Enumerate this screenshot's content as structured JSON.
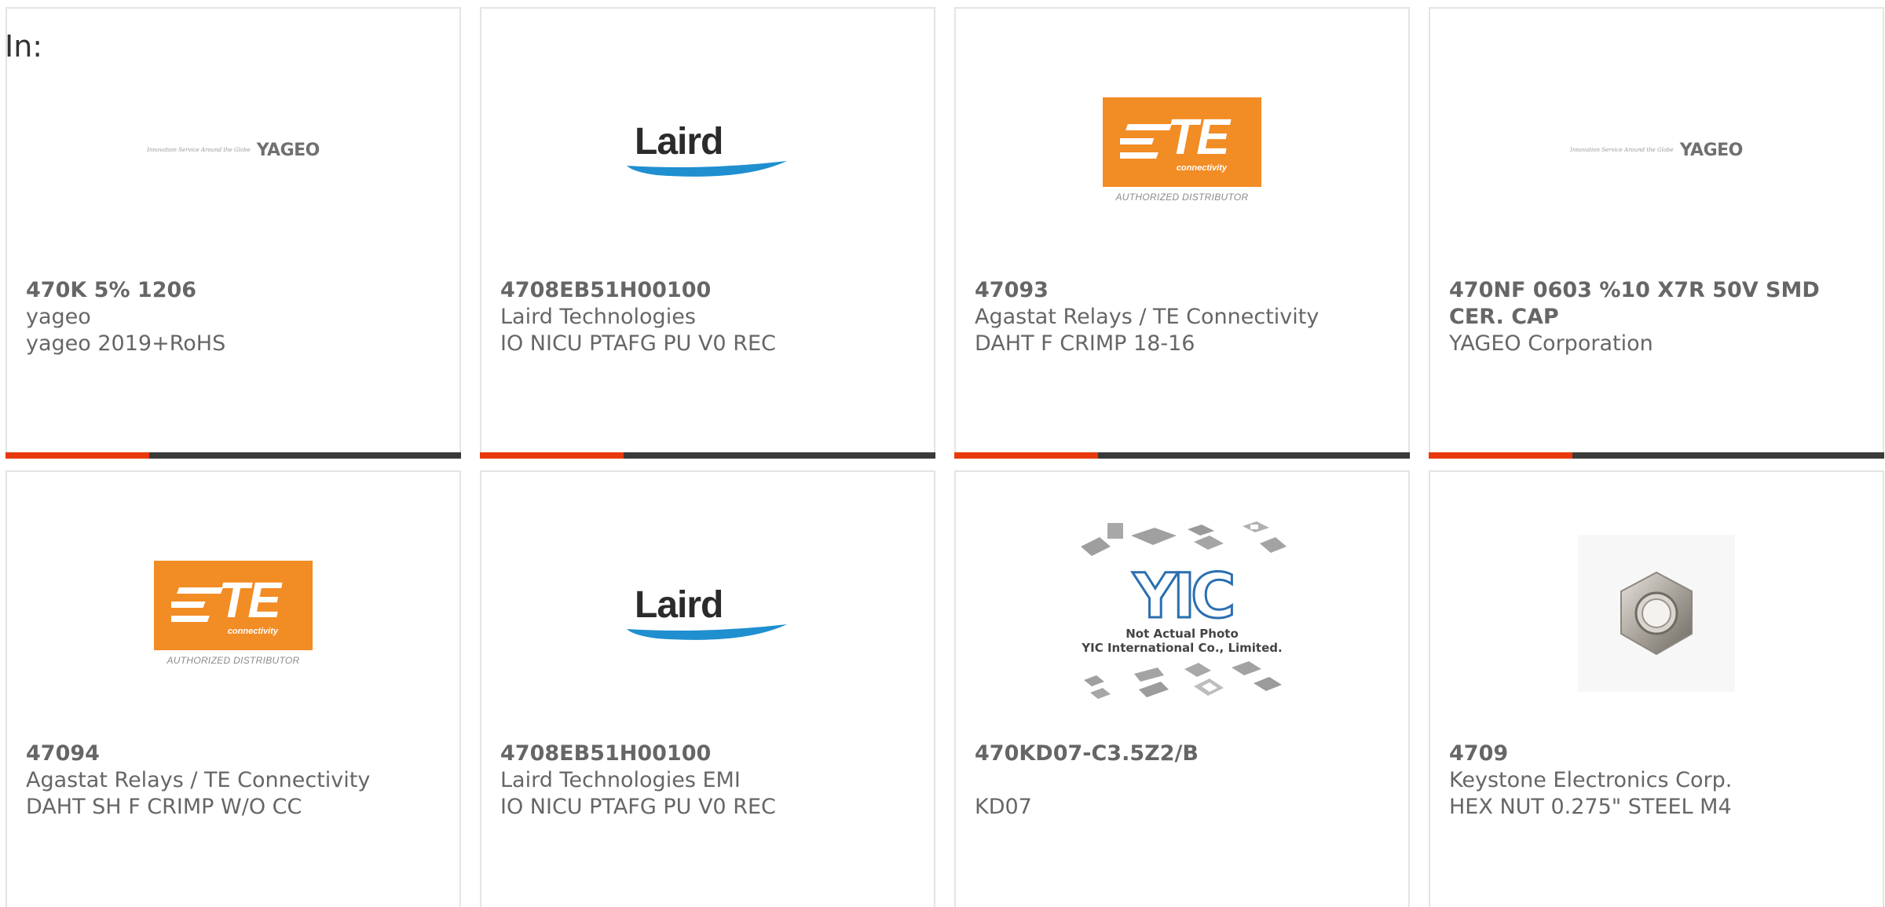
{
  "filter": {
    "label": "In:"
  },
  "products": [
    {
      "part_number": "470K 5% 1206",
      "manufacturer": "yageo",
      "description": "yageo 2019+RoHS",
      "logo": "yageo"
    },
    {
      "part_number": "4708EB51H00100",
      "manufacturer": "Laird Technologies",
      "description": "IO NICU PTAFG PU V0 REC",
      "logo": "laird"
    },
    {
      "part_number": "47093",
      "manufacturer": "Agastat Relays / TE Connectivity",
      "description": "DAHT F CRIMP 18-16",
      "logo": "te"
    },
    {
      "part_number": "470NF 0603 %10 X7R 50V SMD CER. CAP",
      "manufacturer": "YAGEO Corporation",
      "description": "",
      "logo": "yageo"
    },
    {
      "part_number": "47094",
      "manufacturer": "Agastat Relays / TE Connectivity",
      "description": "DAHT SH F CRIMP W/O CC",
      "logo": "te"
    },
    {
      "part_number": "4708EB51H00100",
      "manufacturer": "Laird Technologies EMI",
      "description": "IO NICU PTAFG PU V0 REC",
      "logo": "laird"
    },
    {
      "part_number": "470KD07-C3.5Z2/B",
      "manufacturer": "",
      "description": "KD07",
      "logo": "yic"
    },
    {
      "part_number": "4709",
      "manufacturer": "Keystone Electronics Corp.",
      "description": "HEX NUT 0.275\" STEEL M4",
      "logo": "hex-nut-photo"
    }
  ],
  "logos": {
    "yageo": {
      "tagline": "Innovation Service Around the Globe",
      "word": "YAGEO"
    },
    "laird": {
      "word": "Laird"
    },
    "te": {
      "mark": "TE",
      "sub": "connectivity",
      "badge": "AUTHORIZED DISTRIBUTOR"
    },
    "yic": {
      "mark": "YIC",
      "line1": "Not Actual Photo",
      "line2": "YIC International Co., Limited."
    }
  },
  "colors": {
    "accent": "#e8380d",
    "bar": "#3a3a3a",
    "te_orange": "#f28c24",
    "laird_blue": "#1f8fd0",
    "text": "#666666"
  }
}
